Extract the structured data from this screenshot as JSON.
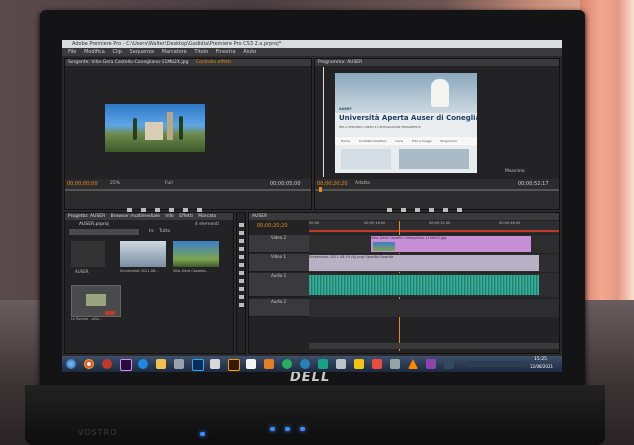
{
  "app": {
    "window_title": "Adobe Premiere Pro - C:\\Users\\Walter\\Desktop\\Gadidia\\Premiere Pro CS3 2.x.prproj*",
    "menu": [
      "File",
      "Modifica",
      "Clip",
      "Sequenza",
      "Marcatore",
      "Titolo",
      "Finestra",
      "Aiuto"
    ]
  },
  "source_panel": {
    "tab_label": "Sorgente: Villa-Gera Castello-Conegliano-11Mb2X.jpg",
    "tab2_label": "Controllo effetti",
    "timecode_left": "00;00;00;00",
    "zoom": "25%",
    "timecode_right": "00;00;05;00",
    "fit": "Full"
  },
  "program_panel": {
    "tab_label": "Programma: AUSER",
    "timecode_left": "00;00;20;20",
    "fit": "Adatta",
    "timecode_right": "00;00;52;17",
    "quality": "Massima",
    "slide": {
      "brand": "auser",
      "heading": "Università Aperta Auser di Conegliano",
      "subheading": "PER IL PENSIERO LIBERO E L'INTEGRAZIONE PERMANENTE",
      "nav": [
        "Home",
        "Comitato Direttivo",
        "Corsi",
        "Foto e Viaggi",
        "Programmi"
      ]
    }
  },
  "project_panel": {
    "tab_label": "Progetto: AUSER",
    "tabs": [
      "Browser multimediale",
      "Info",
      "Effetti",
      "Marcato"
    ],
    "file_name": "AUSER.prproj",
    "item_count": "4 elementi",
    "in_label": "In:",
    "in_value": "Tutto",
    "items": [
      {
        "label": "AUSER",
        "sub": ""
      },
      {
        "label": "Screenshot 2021-08...",
        "sub": ""
      },
      {
        "label": "Villa-Gera Castello...",
        "sub": ""
      },
      {
        "label": "Le Rovine - villa...",
        "sub": ""
      }
    ]
  },
  "timeline": {
    "tab_label": "AUSER",
    "timecode": "00;00;20;20",
    "ruler": [
      "00;00",
      "00;00;16;00",
      "00;00;32;00",
      "00;00;48;00"
    ],
    "tracks": [
      {
        "name": "Video 2"
      },
      {
        "name": "Video 1"
      },
      {
        "name": "Audio 1"
      },
      {
        "name": "Audio 2"
      }
    ],
    "clip_video2": "Villa-Gera Castello Conegliano-11Mb2X.jpg",
    "clip_video1": "Screenshot 2021-08-19 (6).png Opacità:Opacità"
  },
  "taskbar": {
    "clock_time": "15:25",
    "clock_date": "12/08/2021"
  },
  "laptop": {
    "brand": "DELL",
    "model": "VOSTRO"
  },
  "colors": {
    "timecode": "#e98a1a",
    "accent_purple": "#c78fd6",
    "audio_wave": "#2e9c8a"
  }
}
